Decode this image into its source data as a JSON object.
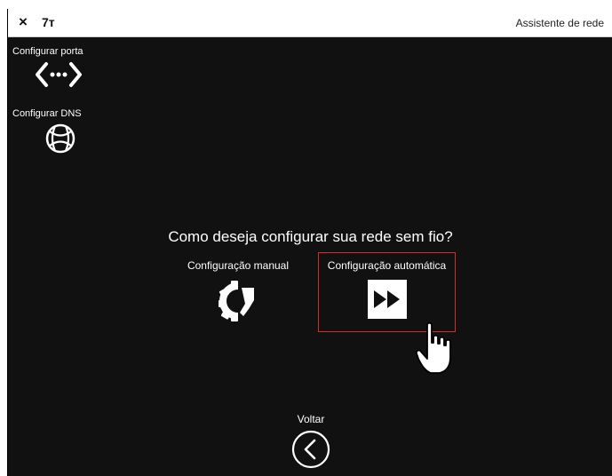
{
  "titlebar": {
    "close_glyph": "×",
    "device_name": "7т",
    "assistant_title": "Assistente de rede"
  },
  "sidebar": {
    "items": [
      {
        "label": "Configurar porta",
        "icon": "port-arrows-icon"
      },
      {
        "label": "Configurar DNS",
        "icon": "globe-icon"
      }
    ]
  },
  "main": {
    "question": "Como deseja configurar sua rede sem fio?",
    "options": [
      {
        "label": "Configuração manual",
        "icon": "manual-gear-icon",
        "selected": false
      },
      {
        "label": "Configuração automática",
        "icon": "fast-forward-icon",
        "selected": true
      }
    ]
  },
  "footer": {
    "back_label": "Voltar",
    "back_icon": "chevron-left-circle-icon"
  },
  "colors": {
    "background": "#111111",
    "titlebar": "#ffffff",
    "accent_selected_border": "#d42a2a",
    "text": "#ffffff"
  }
}
